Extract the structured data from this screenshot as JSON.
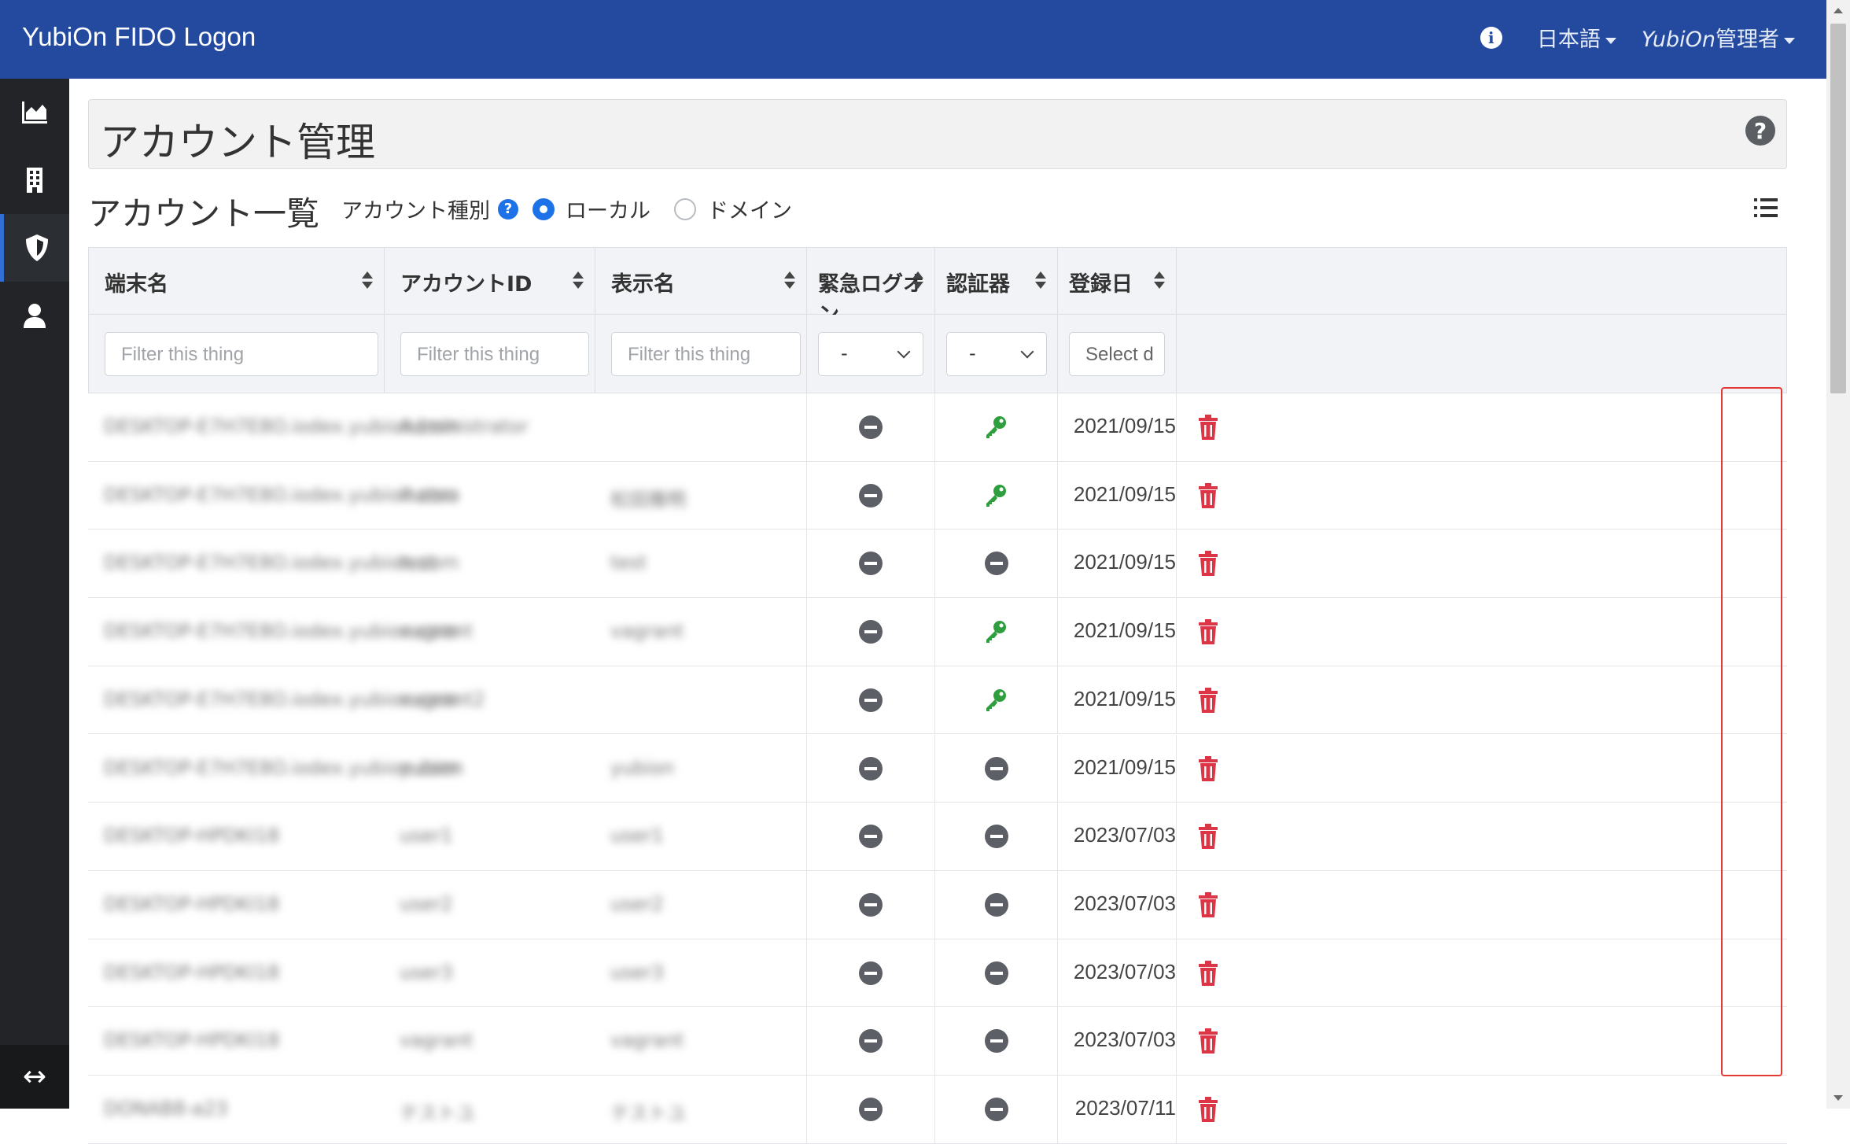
{
  "navbar": {
    "brand": "YubiOn FIDO Logon",
    "language": "日本語",
    "user_prefix": "YubiOn",
    "user_suffix": "管理者",
    "info_icon": "info-icon"
  },
  "sidebar": {
    "items": [
      {
        "name": "dashboard",
        "icon": "area-chart-icon"
      },
      {
        "name": "organization",
        "icon": "building-icon"
      },
      {
        "name": "security",
        "icon": "shield-icon"
      },
      {
        "name": "accounts",
        "icon": "user-icon"
      }
    ],
    "collapse_icon": "expand-horizontal-icon",
    "active_index": 2
  },
  "page": {
    "title": "アカウント管理",
    "section_title": "アカウント一覧",
    "account_type_label": "アカウント種別",
    "radio_local": "ローカル",
    "radio_domain": "ドメイン",
    "selected_type": "ローカル"
  },
  "table": {
    "columns": [
      "端末名",
      "アカウントID",
      "表示名",
      "緊急ログオン",
      "認証器",
      "登録日"
    ],
    "filters": {
      "text_placeholder": "Filter this thing",
      "emergency_value": "-",
      "authenticator_value": "-",
      "date_placeholder": "Select d"
    },
    "rows": [
      {
        "terminal": "DESKTOP-E7H7E8O.iodex.yubion.com",
        "account": "Administrator",
        "display": "",
        "emergency": "none",
        "authenticator": "key",
        "date": "2021/09/15"
      },
      {
        "terminal": "DESKTOP-E7H7E8O.iodex.yubion.com",
        "account": "ihatsu",
        "display": "松田雅明",
        "emergency": "none",
        "authenticator": "key",
        "date": "2021/09/15"
      },
      {
        "terminal": "DESKTOP-E7H7E8O.iodex.yubion.com",
        "account": "test",
        "display": "test",
        "emergency": "none",
        "authenticator": "none",
        "date": "2021/09/15"
      },
      {
        "terminal": "DESKTOP-E7H7E8O.iodex.yubion.com",
        "account": "vagrant",
        "display": "vagrant",
        "emergency": "none",
        "authenticator": "key",
        "date": "2021/09/15"
      },
      {
        "terminal": "DESKTOP-E7H7E8O.iodex.yubion.com",
        "account": "vagrant2",
        "display": "",
        "emergency": "none",
        "authenticator": "key",
        "date": "2021/09/15"
      },
      {
        "terminal": "DESKTOP-E7H7E8O.iodex.yubion.com",
        "account": "yubion",
        "display": "yubion",
        "emergency": "none",
        "authenticator": "none",
        "date": "2021/09/15"
      },
      {
        "terminal": "DESKTOP-HPDKI18",
        "account": "user1",
        "display": "user1",
        "emergency": "none",
        "authenticator": "none",
        "date": "2023/07/03"
      },
      {
        "terminal": "DESKTOP-HPDKI18",
        "account": "user2",
        "display": "user2",
        "emergency": "none",
        "authenticator": "none",
        "date": "2023/07/03"
      },
      {
        "terminal": "DESKTOP-HPDKI18",
        "account": "user3",
        "display": "user3",
        "emergency": "none",
        "authenticator": "none",
        "date": "2023/07/03"
      },
      {
        "terminal": "DESKTOP-HPDKI18",
        "account": "vagrant",
        "display": "vagrant",
        "emergency": "none",
        "authenticator": "none",
        "date": "2023/07/03"
      },
      {
        "terminal": "DONAB8-a23",
        "account": "テストユ",
        "display": "テストユ",
        "emergency": "none",
        "authenticator": "none",
        "date": "2023/07/11"
      }
    ]
  },
  "colors": {
    "navbar": "#244a9f",
    "sidebar": "#222427",
    "key_green": "#2e9e3e",
    "trash_red": "#dc3545",
    "highlight": "#e53935"
  }
}
